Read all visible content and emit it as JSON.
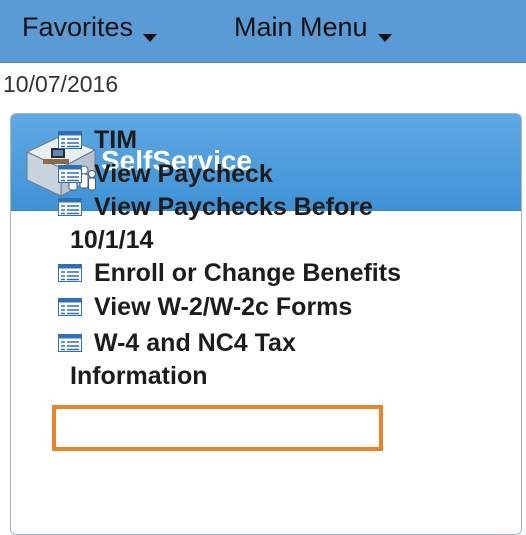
{
  "topbar": {
    "favorites_label": "Favorites",
    "main_menu_label": "Main Menu"
  },
  "date": "10/07/2016",
  "panel": {
    "title": "SelfService",
    "links": [
      {
        "label": "TIM"
      },
      {
        "label": "View Paycheck"
      },
      {
        "label": "View Paychecks Before",
        "label2": "10/1/14"
      },
      {
        "label": "Enroll or Change Benefits"
      },
      {
        "label": "View W-2/W-2c Forms",
        "highlighted": true
      },
      {
        "label": "W-4 and NC4 Tax",
        "label2": "Information"
      }
    ]
  },
  "colors": {
    "topbar": "#5b9bd5",
    "panel_header": "#4a9ddd",
    "highlight_border": "#e8832e",
    "link_icon": "#2f6fb6"
  },
  "icons": {
    "menu_caret": "chevron-down-icon",
    "header": "self-service-icon",
    "link": "list-page-icon"
  }
}
